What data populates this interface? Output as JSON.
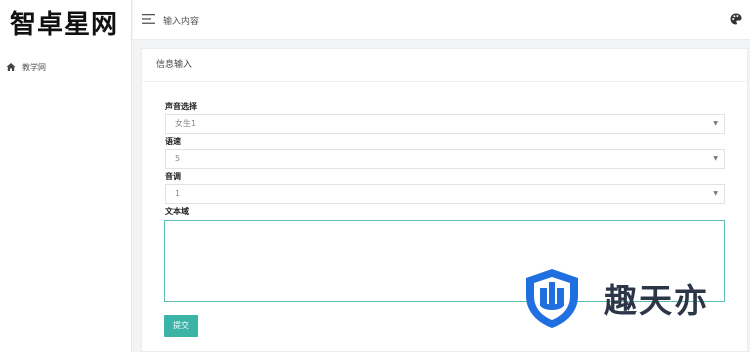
{
  "sidebar": {
    "brand": "智卓星网",
    "items": [
      {
        "label": "教学网",
        "icon": "home-icon"
      }
    ]
  },
  "topbar": {
    "title": "输入内容",
    "menu_icon": "menu-icon",
    "theme_icon": "palette-icon"
  },
  "card": {
    "title": "信息输入",
    "fields": {
      "voice": {
        "label": "声音选择",
        "value": "女生1"
      },
      "speed": {
        "label": "语速",
        "value": "5"
      },
      "pitch": {
        "label": "音调",
        "value": "1"
      },
      "text": {
        "label": "文本域",
        "value": ""
      }
    },
    "submit_label": "提交"
  },
  "watermark": {
    "text": "趣天亦",
    "colors": {
      "blue": "#1f6fe0",
      "dark": "#2d3648"
    }
  },
  "colors": {
    "accent": "#3cb3a7",
    "focus_border": "#5fbcb3",
    "background": "#f2f3f5"
  }
}
